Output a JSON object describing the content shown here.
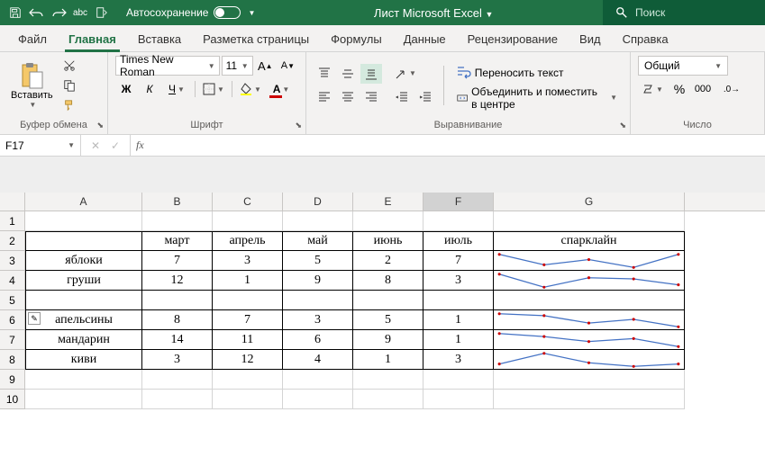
{
  "titlebar": {
    "autosave_label": "Автосохранение",
    "title": "Лист Microsoft Excel",
    "search_placeholder": "Поиск"
  },
  "tabs": [
    "Файл",
    "Главная",
    "Вставка",
    "Разметка страницы",
    "Формулы",
    "Данные",
    "Рецензирование",
    "Вид",
    "Справка"
  ],
  "active_tab": 1,
  "ribbon": {
    "clipboard": {
      "label": "Буфер обмена",
      "paste": "Вставить"
    },
    "font": {
      "label": "Шрифт",
      "font_name": "Times New Roman",
      "font_size": "11",
      "bold": "Ж",
      "italic": "К",
      "underline": "Ч"
    },
    "alignment": {
      "label": "Выравнивание",
      "wrap": "Переносить текст",
      "merge": "Объединить и поместить в центре"
    },
    "number": {
      "label": "Число",
      "format": "Общий"
    }
  },
  "namebox": "F17",
  "grid": {
    "columns": [
      "A",
      "B",
      "C",
      "D",
      "E",
      "F",
      "G"
    ],
    "selected_col": "F",
    "headers": {
      "A": "",
      "B": "март",
      "C": "апрель",
      "D": "май",
      "E": "июнь",
      "F": "июль",
      "G": "спарклайн"
    },
    "rows": [
      {
        "r": 3,
        "A": "яблоки",
        "B": "7",
        "C": "3",
        "D": "5",
        "E": "2",
        "F": "7"
      },
      {
        "r": 4,
        "A": "груши",
        "B": "12",
        "C": "1",
        "D": "9",
        "E": "8",
        "F": "3"
      },
      {
        "r": 5,
        "A": "",
        "B": "",
        "C": "",
        "D": "",
        "E": "",
        "F": ""
      },
      {
        "r": 6,
        "A": "апельсины",
        "B": "8",
        "C": "7",
        "D": "3",
        "E": "5",
        "F": "1",
        "tag": true
      },
      {
        "r": 7,
        "A": "мандарин",
        "B": "14",
        "C": "11",
        "D": "6",
        "E": "9",
        "F": "1"
      },
      {
        "r": 8,
        "A": "киви",
        "B": "3",
        "C": "12",
        "D": "4",
        "E": "1",
        "F": "3"
      }
    ],
    "total_rows": 10
  },
  "chart_data": [
    {
      "type": "line",
      "categories": [
        "март",
        "апрель",
        "май",
        "июнь",
        "июль"
      ],
      "values": [
        7,
        3,
        5,
        2,
        7
      ],
      "row": 3
    },
    {
      "type": "line",
      "categories": [
        "март",
        "апрель",
        "май",
        "июнь",
        "июль"
      ],
      "values": [
        12,
        1,
        9,
        8,
        3
      ],
      "row": 4
    },
    {
      "type": "line",
      "categories": [
        "март",
        "апрель",
        "май",
        "июнь",
        "июль"
      ],
      "values": [
        8,
        7,
        3,
        5,
        1
      ],
      "row": 6
    },
    {
      "type": "line",
      "categories": [
        "март",
        "апрель",
        "май",
        "июнь",
        "июль"
      ],
      "values": [
        14,
        11,
        6,
        9,
        1
      ],
      "row": 7
    },
    {
      "type": "line",
      "categories": [
        "март",
        "апрель",
        "май",
        "июнь",
        "июль"
      ],
      "values": [
        3,
        12,
        4,
        1,
        3
      ],
      "row": 8
    }
  ]
}
